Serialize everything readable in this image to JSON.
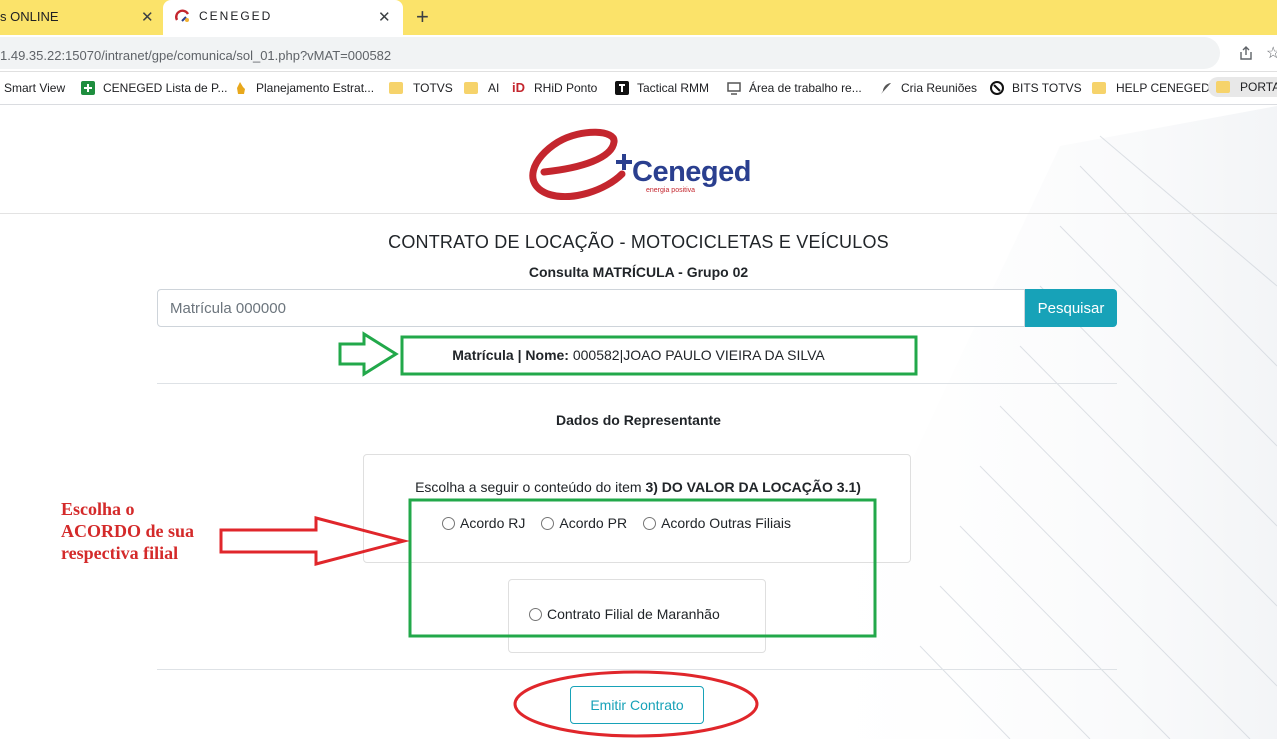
{
  "browser": {
    "tabs": [
      {
        "title": "s ONLINE",
        "active": false
      },
      {
        "title": "CENEGED",
        "active": true
      }
    ],
    "url": "1.49.35.22:15070/intranet/gpe/comunica/sol_01.php?vMAT=000582",
    "bookmarks": [
      "Smart View",
      "CENEGED Lista de P...",
      "Planejamento Estrat...",
      "TOTVS",
      "AI",
      "RHiD Ponto",
      "Tactical RMM",
      "Área de trabalho re...",
      "Cria Reuniões",
      "BITS TOTVS",
      "HELP CENEGED",
      "PORTAL"
    ]
  },
  "brand": {
    "name": "Ceneged",
    "tagline": "energia positiva",
    "colors": {
      "blue": "#2a3f8f",
      "red": "#c4262e",
      "accent": "#17a2b8"
    }
  },
  "page": {
    "title": "CONTRATO DE LOCAÇÃO - MOTOCICLETAS E VEÍCULOS",
    "subtitle": "Consulta MATRÍCULA - Grupo 02",
    "search": {
      "placeholder": "Matrícula 000000",
      "button": "Pesquisar"
    },
    "matricula": {
      "label": "Matrícula | Nome:",
      "value": "000582|JOAO PAULO VIEIRA DA SILVA"
    },
    "section_title": "Dados do Representante",
    "choice": {
      "prompt": "Escolha a seguir o conteúdo do item",
      "prompt_bold": "3) DO VALOR DA LOCAÇÃO 3.1)",
      "options": [
        "Acordo RJ",
        "Acordo PR",
        "Acordo Outras Filiais"
      ],
      "extra_option": "Contrato Filial de Maranhão"
    },
    "submit": "Emitir Contrato"
  },
  "annotation": {
    "text": "Escolha o ACORDO de sua respectiva filial",
    "colors": {
      "red": "#e0262b",
      "green": "#22a84a"
    }
  }
}
